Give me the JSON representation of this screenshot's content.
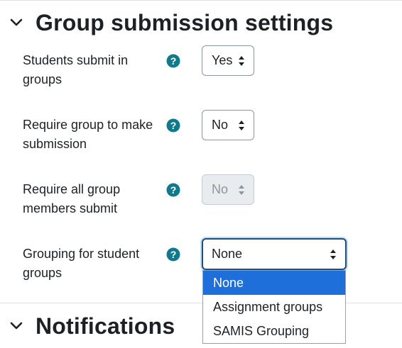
{
  "sections": {
    "group_submission": {
      "title": "Group submission settings"
    },
    "notifications": {
      "title": "Notifications"
    }
  },
  "fields": [
    {
      "label": "Students submit in groups",
      "value": "Yes",
      "disabled": false
    },
    {
      "label": "Require group to make submission",
      "value": "No",
      "disabled": false
    },
    {
      "label": "Require all group members submit",
      "value": "No",
      "disabled": true
    },
    {
      "label": "Grouping for student groups",
      "value": "None",
      "disabled": false,
      "open": true
    }
  ],
  "grouping_options": [
    "None",
    "Assignment groups",
    "SAMIS Grouping"
  ],
  "colors": {
    "help_icon": "#0f6cbf",
    "selected_option": "#1e6fd9",
    "focus_border": "#1f4e79"
  },
  "icons": {
    "section_toggle": "chevron-down-icon",
    "help": "question-circle-icon",
    "select_arrows": "sort-arrows-icon"
  }
}
